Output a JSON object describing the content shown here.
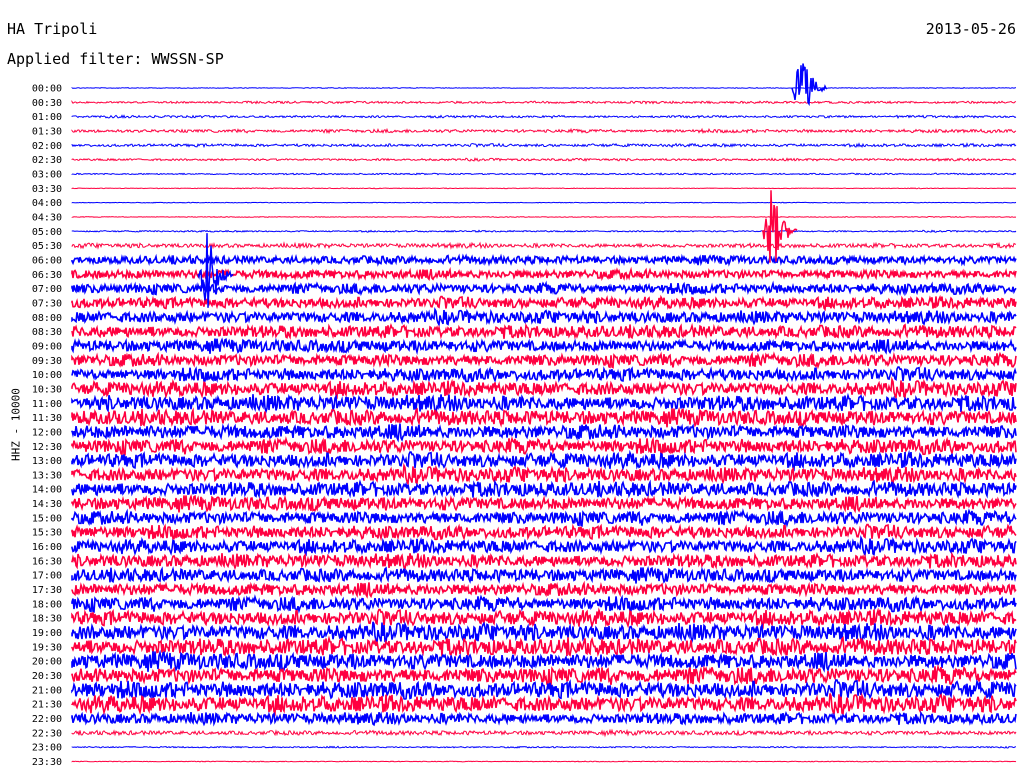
{
  "header": {
    "station": "HA Tripoli",
    "date": "2013-05-26",
    "filter": "Applied filter: WWSSN-SP"
  },
  "chart_data": {
    "type": "line",
    "title": "",
    "xlabel": "",
    "ylabel": "HHZ - 10000",
    "rows": [
      {
        "time": "00:00",
        "color": "#0000ff",
        "amp": 0.2
      },
      {
        "time": "00:30",
        "color": "#ff0040",
        "amp": 0.6
      },
      {
        "time": "01:00",
        "color": "#0000ff",
        "amp": 0.6
      },
      {
        "time": "01:30",
        "color": "#ff0040",
        "amp": 0.9
      },
      {
        "time": "02:00",
        "color": "#0000ff",
        "amp": 0.8
      },
      {
        "time": "02:30",
        "color": "#ff0040",
        "amp": 0.6
      },
      {
        "time": "03:00",
        "color": "#0000ff",
        "amp": 0.4
      },
      {
        "time": "03:30",
        "color": "#ff0040",
        "amp": 0.2
      },
      {
        "time": "04:00",
        "color": "#0000ff",
        "amp": 0.2
      },
      {
        "time": "04:30",
        "color": "#ff0040",
        "amp": 0.2
      },
      {
        "time": "05:00",
        "color": "#0000ff",
        "amp": 0.4
      },
      {
        "time": "05:30",
        "color": "#ff0040",
        "amp": 1.2
      },
      {
        "time": "06:00",
        "color": "#0000ff",
        "amp": 2.2
      },
      {
        "time": "06:30",
        "color": "#ff0040",
        "amp": 2.6
      },
      {
        "time": "07:00",
        "color": "#0000ff",
        "amp": 2.8
      },
      {
        "time": "07:30",
        "color": "#ff0040",
        "amp": 3.0
      },
      {
        "time": "08:00",
        "color": "#0000ff",
        "amp": 3.2
      },
      {
        "time": "08:30",
        "color": "#ff0040",
        "amp": 3.4
      },
      {
        "time": "09:00",
        "color": "#0000ff",
        "amp": 3.4
      },
      {
        "time": "09:30",
        "color": "#ff0040",
        "amp": 3.5
      },
      {
        "time": "10:00",
        "color": "#0000ff",
        "amp": 3.5
      },
      {
        "time": "10:30",
        "color": "#ff0040",
        "amp": 3.8
      },
      {
        "time": "11:00",
        "color": "#0000ff",
        "amp": 4.2
      },
      {
        "time": "11:30",
        "color": "#ff0040",
        "amp": 4.2
      },
      {
        "time": "12:00",
        "color": "#0000ff",
        "amp": 4.2
      },
      {
        "time": "12:30",
        "color": "#ff0040",
        "amp": 4.0
      },
      {
        "time": "13:00",
        "color": "#0000ff",
        "amp": 4.0
      },
      {
        "time": "13:30",
        "color": "#ff0040",
        "amp": 3.8
      },
      {
        "time": "14:00",
        "color": "#0000ff",
        "amp": 4.0
      },
      {
        "time": "14:30",
        "color": "#ff0040",
        "amp": 3.8
      },
      {
        "time": "15:00",
        "color": "#0000ff",
        "amp": 3.8
      },
      {
        "time": "15:30",
        "color": "#ff0040",
        "amp": 3.6
      },
      {
        "time": "16:00",
        "color": "#0000ff",
        "amp": 3.6
      },
      {
        "time": "16:30",
        "color": "#ff0040",
        "amp": 3.6
      },
      {
        "time": "17:00",
        "color": "#0000ff",
        "amp": 3.6
      },
      {
        "time": "17:30",
        "color": "#ff0040",
        "amp": 3.6
      },
      {
        "time": "18:00",
        "color": "#0000ff",
        "amp": 3.8
      },
      {
        "time": "18:30",
        "color": "#ff0040",
        "amp": 4.0
      },
      {
        "time": "19:00",
        "color": "#0000ff",
        "amp": 4.4
      },
      {
        "time": "19:30",
        "color": "#ff0040",
        "amp": 4.6
      },
      {
        "time": "20:00",
        "color": "#0000ff",
        "amp": 4.6
      },
      {
        "time": "20:30",
        "color": "#ff0040",
        "amp": 4.6
      },
      {
        "time": "21:00",
        "color": "#0000ff",
        "amp": 4.6
      },
      {
        "time": "21:30",
        "color": "#ff0040",
        "amp": 4.4
      },
      {
        "time": "22:00",
        "color": "#0000ff",
        "amp": 3.0
      },
      {
        "time": "22:30",
        "color": "#ff0040",
        "amp": 1.2
      },
      {
        "time": "23:00",
        "color": "#0000ff",
        "amp": 0.4
      },
      {
        "time": "23:30",
        "color": "#ff0040",
        "amp": 0.2
      }
    ]
  }
}
